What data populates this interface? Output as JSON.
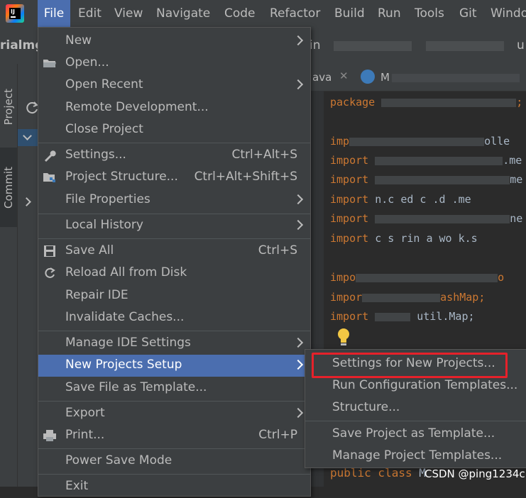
{
  "menubar": {
    "items": [
      "File",
      "Edit",
      "View",
      "Navigate",
      "Code",
      "Refactor",
      "Build",
      "Run",
      "Tools",
      "Git",
      "Windo"
    ],
    "active": "File"
  },
  "breadcrumb": {
    "project": "rialmg",
    "tail": "in",
    "tail2": "u"
  },
  "side_tabs": {
    "project": "Project",
    "commit": "Commit"
  },
  "editor": {
    "tab_label": "ava",
    "tab_label2": "M",
    "lines": [
      {
        "kw": "package",
        "rest": ";"
      },
      {
        "kw": "imp",
        "rest": "olle"
      },
      {
        "kw": "import",
        "rest": ".me"
      },
      {
        "kw": "import",
        "rest": "me"
      },
      {
        "kw": "import",
        "rest": "n.c  ed  c    .d .me"
      },
      {
        "kw": "import",
        "rest": "ne"
      },
      {
        "kw": "import",
        "rest": "  c s  rin  a  wo k.s"
      },
      {
        "kw": "impo",
        "rest": "o"
      },
      {
        "kw": "impor",
        "rest": "ashMap;"
      },
      {
        "kw": "import",
        "rest": " util.Map;"
      }
    ],
    "public_line": {
      "kw": "public class",
      "rest": "M"
    }
  },
  "file_menu": {
    "items": [
      {
        "label": "New",
        "shortcut": "",
        "arrow": true,
        "icon": ""
      },
      {
        "label": "Open...",
        "shortcut": "",
        "arrow": false,
        "icon": "folder-icon"
      },
      {
        "label": "Open Recent",
        "shortcut": "",
        "arrow": true,
        "icon": ""
      },
      {
        "label": "Remote Development...",
        "shortcut": "",
        "arrow": false,
        "icon": ""
      },
      {
        "label": "Close Project",
        "shortcut": "",
        "arrow": false,
        "icon": ""
      },
      {
        "label": "Settings...",
        "shortcut": "Ctrl+Alt+S",
        "arrow": false,
        "icon": "wrench-icon"
      },
      {
        "label": "Project Structure...",
        "shortcut": "Ctrl+Alt+Shift+S",
        "arrow": false,
        "icon": "project-structure-icon"
      },
      {
        "label": "File Properties",
        "shortcut": "",
        "arrow": true,
        "icon": ""
      },
      {
        "label": "Local History",
        "shortcut": "",
        "arrow": true,
        "icon": ""
      },
      {
        "label": "Save All",
        "shortcut": "Ctrl+S",
        "arrow": false,
        "icon": "save-icon"
      },
      {
        "label": "Reload All from Disk",
        "shortcut": "",
        "arrow": false,
        "icon": "reload-icon"
      },
      {
        "label": "Repair IDE",
        "shortcut": "",
        "arrow": false,
        "icon": ""
      },
      {
        "label": "Invalidate Caches...",
        "shortcut": "",
        "arrow": false,
        "icon": ""
      },
      {
        "label": "Manage IDE Settings",
        "shortcut": "",
        "arrow": true,
        "icon": ""
      },
      {
        "label": "New Projects Setup",
        "shortcut": "",
        "arrow": true,
        "icon": ""
      },
      {
        "label": "Save File as Template...",
        "shortcut": "",
        "arrow": false,
        "icon": ""
      },
      {
        "label": "Export",
        "shortcut": "",
        "arrow": true,
        "icon": ""
      },
      {
        "label": "Print...",
        "shortcut": "Ctrl+P",
        "arrow": false,
        "icon": "print-icon"
      },
      {
        "label": "Power Save Mode",
        "shortcut": "",
        "arrow": false,
        "icon": ""
      },
      {
        "label": "Exit",
        "shortcut": "",
        "arrow": false,
        "icon": ""
      }
    ],
    "selected": "New Projects Setup"
  },
  "submenu": {
    "items": [
      "Settings for New Projects...",
      "Run Configuration Templates...",
      "Structure...",
      "Save Project as Template...",
      "Manage Project Templates..."
    ],
    "highlighted": "Settings for New Projects..."
  },
  "watermark": "CSDN @ping1234c",
  "colors": {
    "menu_bg": "#3c3f41",
    "selection": "#4b6eaf",
    "editor_bg": "#2b2b2b",
    "keyword": "#cc7832",
    "highlight_box": "#e6212a"
  }
}
